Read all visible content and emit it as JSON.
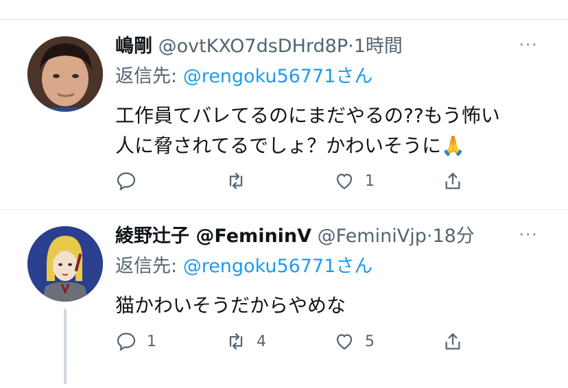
{
  "tweets": [
    {
      "display_name": "嶋剛",
      "handle": "@ovtKXO7dsDHrd8P",
      "dot": "·",
      "time": "1時間",
      "more": "···",
      "reply_prefix": "返信先: ",
      "reply_to": "@rengoku56771さん",
      "text_line1": "工作員てバレてるのにまだやるの??もう怖い",
      "text_line2": "人に脅されてるでしょ？かわいそうに🙏",
      "reply_count": "",
      "retweet_count": "",
      "like_count": "1"
    },
    {
      "display_name": "綾野辻子 @FemininV",
      "handle": "@FeminiVjp",
      "dot": "·",
      "time": "18分",
      "more": "···",
      "reply_prefix": "返信先: ",
      "reply_to": "@rengoku56771さん",
      "text_line1": "猫かわいそうだからやめな",
      "reply_count": "1",
      "retweet_count": "4",
      "like_count": "5"
    }
  ],
  "icons": {
    "reply": "speech-bubble-icon",
    "retweet": "retweet-arrows-icon",
    "like": "heart-icon",
    "share": "share-upload-icon",
    "more": "ellipsis-icon"
  },
  "colors": {
    "link": "#1d9bf0",
    "muted": "#536471",
    "divider": "#e1e8ed",
    "thread_line": "#cfd9de"
  }
}
